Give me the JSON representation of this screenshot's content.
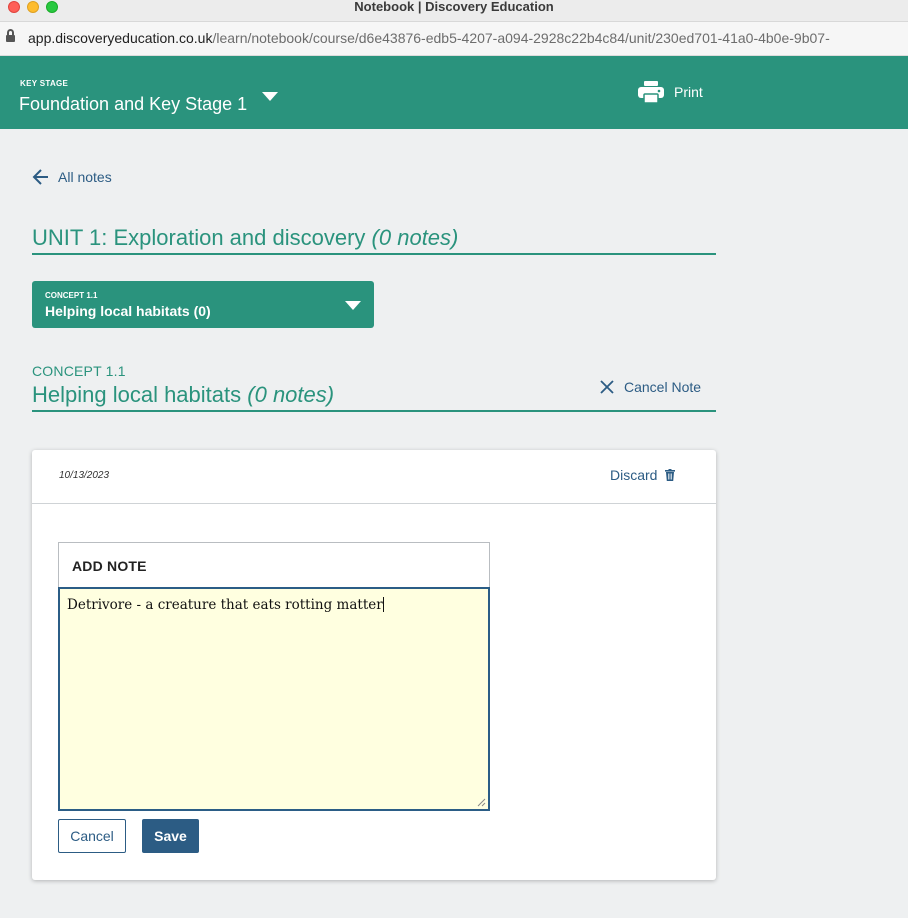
{
  "window": {
    "title": "Notebook | Discovery Education"
  },
  "browser": {
    "url_host": "app.discoveryeducation.co.uk",
    "url_path": "/learn/notebook/course/d6e43876-edb5-4207-a094-2928c22b4c84/unit/230ed701-41a0-4b0e-9b07-"
  },
  "header": {
    "key_stage_label": "KEY STAGE",
    "key_stage_value": "Foundation and Key Stage 1",
    "print_label": "Print"
  },
  "nav": {
    "back_label": "All notes"
  },
  "unit": {
    "title": "UNIT 1: Exploration and discovery",
    "count": "(0 notes)"
  },
  "concept_dropdown": {
    "label": "CONCEPT 1.1",
    "value": "Helping local habitats (0)"
  },
  "concept": {
    "label": "CONCEPT 1.1",
    "title": "Helping local habitats",
    "count": "(0 notes)",
    "cancel_note_label": "Cancel Note"
  },
  "note": {
    "date": "10/13/2023",
    "discard_label": "Discard",
    "add_note_title": "ADD NOTE",
    "text": "Detrivore - a creature that eats rotting matter",
    "cancel_label": "Cancel",
    "save_label": "Save"
  },
  "colors": {
    "brand_green": "#2a937d",
    "link_blue": "#2c5c84",
    "note_background": "#ffffe0"
  },
  "icons": [
    "lock-icon",
    "chevron-down-icon",
    "printer-icon",
    "arrow-left-icon",
    "close-icon",
    "trash-icon",
    "resize-grip-icon"
  ]
}
